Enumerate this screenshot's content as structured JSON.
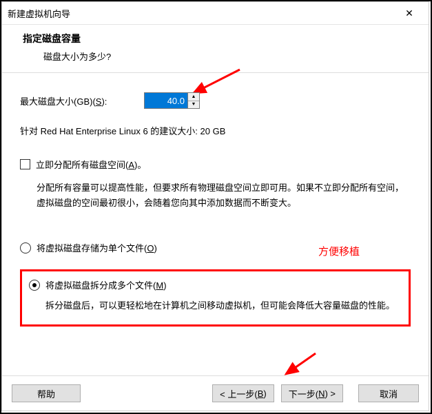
{
  "window": {
    "title": "新建虚拟机向导",
    "close": "✕"
  },
  "header": {
    "heading": "指定磁盘容量",
    "subheading": "磁盘大小为多少?"
  },
  "disk": {
    "size_label_pre": "最大磁盘大小(GB)(",
    "size_label_key": "S",
    "size_label_post": "):",
    "size_value": "40.0",
    "recommend": "针对 Red Hat Enterprise Linux 6 的建议大小: 20 GB"
  },
  "allocate": {
    "label_pre": "立即分配所有磁盘空间(",
    "label_key": "A",
    "label_post": ")。",
    "desc": "分配所有容量可以提高性能，但要求所有物理磁盘空间立即可用。如果不立即分配所有空间，虚拟磁盘的空间最初很小，会随着您向其中添加数据而不断变大。"
  },
  "storage": {
    "single_pre": "将虚拟磁盘存储为单个文件(",
    "single_key": "O",
    "single_post": ")",
    "split_pre": "将虚拟磁盘拆分成多个文件(",
    "split_key": "M",
    "split_post": ")",
    "split_desc": "拆分磁盘后，可以更轻松地在计算机之间移动虚拟机，但可能会降低大容量磁盘的性能。",
    "selected": "split"
  },
  "annotation": {
    "text": "方便移植",
    "color": "#ff0000"
  },
  "buttons": {
    "help": "帮助",
    "back_pre": "< 上一步(",
    "back_key": "B",
    "back_post": ")",
    "next_pre": "下一步(",
    "next_key": "N",
    "next_post": ") >",
    "cancel": "取消"
  }
}
